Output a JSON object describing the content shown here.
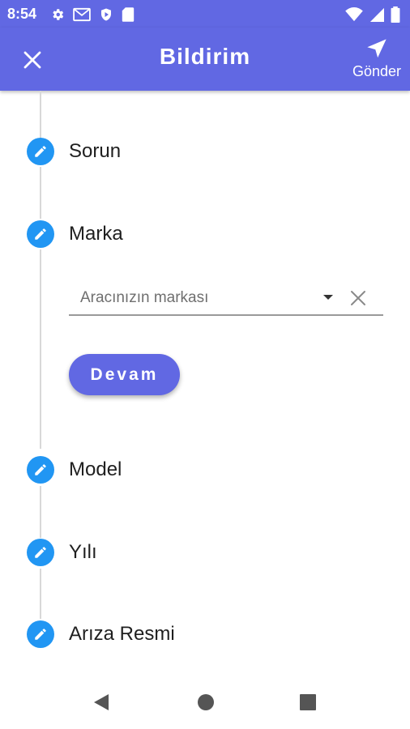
{
  "status_bar": {
    "time": "8:54",
    "left_icons": [
      "gear-icon",
      "gmail-icon",
      "shield-icon",
      "sd-card-icon"
    ],
    "right_icons": [
      "wifi-icon",
      "signal-icon",
      "battery-icon"
    ]
  },
  "app_bar": {
    "title": "Bildirim",
    "send_label": "Gönder",
    "close_icon": "close-icon",
    "send_icon": "navigation-arrow-icon"
  },
  "steps": [
    {
      "label": "Sorun",
      "icon": "pencil-icon"
    },
    {
      "label": "Marka",
      "icon": "pencil-icon"
    },
    {
      "label": "Model",
      "icon": "pencil-icon"
    },
    {
      "label": "Yılı",
      "icon": "pencil-icon"
    },
    {
      "label": "Arıza Resmi",
      "icon": "pencil-icon"
    }
  ],
  "brand_step": {
    "dropdown_placeholder": "Aracınızın markası",
    "continue_label": "Devam"
  },
  "nav_bar": {
    "icons": [
      "back-icon",
      "home-icon",
      "recents-icon"
    ]
  },
  "colors": {
    "primary": "#6168e3",
    "step_icon": "#2196f3",
    "timeline": "#d8d8d8"
  }
}
